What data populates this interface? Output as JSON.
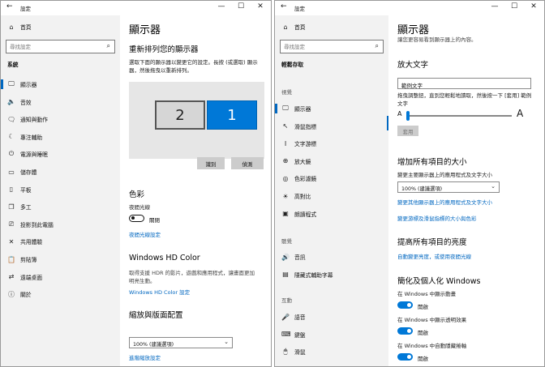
{
  "left_window": {
    "title": "設定",
    "controls": {
      "minimize": "—",
      "maximize": "☐",
      "close": "✕"
    },
    "nav": {
      "home_label": "首頁",
      "search_placeholder": "尋找設定",
      "section_label": "系統",
      "items": [
        {
          "label": "顯示器",
          "icon": "monitor-icon",
          "glyph": "🖵"
        },
        {
          "label": "音效",
          "icon": "speaker-icon",
          "glyph": "🔈"
        },
        {
          "label": "通知與動作",
          "icon": "notification-icon",
          "glyph": "🗨"
        },
        {
          "label": "專注輔助",
          "icon": "moon-icon",
          "glyph": "☾"
        },
        {
          "label": "電源與睡眠",
          "icon": "power-icon",
          "glyph": "⏻"
        },
        {
          "label": "儲存體",
          "icon": "storage-icon",
          "glyph": "▭"
        },
        {
          "label": "平板",
          "icon": "tablet-icon",
          "glyph": "▯"
        },
        {
          "label": "多工",
          "icon": "multitask-icon",
          "glyph": "❐"
        },
        {
          "label": "投影到此電腦",
          "icon": "project-icon",
          "glyph": "⎚"
        },
        {
          "label": "共用體驗",
          "icon": "shared-icon",
          "glyph": "✕"
        },
        {
          "label": "剪貼簿",
          "icon": "clipboard-icon",
          "glyph": "📋"
        },
        {
          "label": "遠端桌面",
          "icon": "remote-desktop-icon",
          "glyph": "⇄"
        },
        {
          "label": "關於",
          "icon": "info-icon",
          "glyph": "ⓘ"
        }
      ]
    },
    "content": {
      "page_title": "顯示器",
      "arrange_heading": "重新排列您的顯示器",
      "arrange_desc_line1": "選取下面的顯示器以變更它的設定。長按 (或選取) 顯示",
      "arrange_desc_line2": "器，然後拖曳以重新排列。",
      "monitor_2_label": "2",
      "monitor_1_label": "1",
      "identify_button": "識別",
      "detect_button": "偵測",
      "color_heading": "色彩",
      "night_light_label": "夜間光線",
      "night_light_state": "關閉",
      "night_light_link": "夜間光線設定",
      "hd_color_heading": "Windows HD Color",
      "hd_color_desc_line1": "取得支援 HDR 的影片，遊戲和應用程式，讓畫面更加",
      "hd_color_desc_line2": "明亮生動。",
      "hd_color_link": "Windows HD Color 設定",
      "scale_heading": "縮放與版面配置",
      "scale_dropdown_value": "100% (建議選項)",
      "scale_link": "進階縮放設定"
    }
  },
  "right_window": {
    "title": "設定",
    "controls": {
      "minimize": "—",
      "maximize": "☐",
      "close": "✕"
    },
    "nav": {
      "home_label": "首頁",
      "search_placeholder": "尋找設定",
      "section_label": "輕鬆存取",
      "group_vision": "視覺",
      "vision_items": [
        {
          "label": "顯示器",
          "icon": "monitor-icon",
          "glyph": "🖵"
        },
        {
          "label": "滑鼠指標",
          "icon": "mouse-pointer-icon",
          "glyph": "↖"
        },
        {
          "label": "文字游標",
          "icon": "text-cursor-icon",
          "glyph": "I"
        },
        {
          "label": "放大鏡",
          "icon": "magnifier-icon",
          "glyph": "⊕"
        },
        {
          "label": "色彩濾鏡",
          "icon": "color-filter-icon",
          "glyph": "◎"
        },
        {
          "label": "高對比",
          "icon": "high-contrast-icon",
          "glyph": "☀"
        },
        {
          "label": "朗讀程式",
          "icon": "narrator-icon",
          "glyph": "▣"
        }
      ],
      "group_hearing": "聽覺",
      "hearing_items": [
        {
          "label": "音訊",
          "icon": "audio-icon",
          "glyph": "🔊"
        },
        {
          "label": "隱藏式輔助字幕",
          "icon": "closed-caption-icon",
          "glyph": "▤"
        }
      ],
      "group_interaction": "互動",
      "interaction_items": [
        {
          "label": "語音",
          "icon": "microphone-icon",
          "glyph": "🎤"
        },
        {
          "label": "鍵盤",
          "icon": "keyboard-icon",
          "glyph": "⌨"
        },
        {
          "label": "滑鼠",
          "icon": "mouse-icon",
          "glyph": "🖱"
        }
      ]
    },
    "content": {
      "page_title": "顯示器",
      "page_subtitle": "讓您更容易看到顯示器上的內容。",
      "text_size_heading": "放大文字",
      "sample_text": "範例文字",
      "slider_desc_line1": "拖曳調整鈕，直到您輕鬆地讀取，然後按一下 [套用] 範例",
      "slider_desc_line2": "文字",
      "slider_min_label": "A",
      "slider_max_label": "A",
      "slider_value_percent": 0,
      "apply_button": "套用",
      "size_heading": "增加所有項目的大小",
      "size_desc": "變更主要顯示器上的應用程式及文字大小",
      "size_dropdown_value": "100% (建議選項)",
      "other_display_link": "變更其他顯示器上的應用程式及文字大小",
      "pointer_link": "變更游標及滑鼠指標的大小與色彩",
      "brightness_heading": "提高所有項目的亮度",
      "night_light_link": "自動變更亮度，或使用夜間光線",
      "personalize_heading": "簡化及個人化 Windows",
      "animations_label": "在 Windows 中顯示動畫",
      "animations_state": "開啟",
      "transparency_label": "在 Windows 中顯示透明效果",
      "transparency_state": "開啟",
      "scrollbars_label": "在 Windows 中自動隱藏捲軸",
      "scrollbars_state": "開啟"
    }
  },
  "colors": {
    "accent": "#0078d7",
    "link": "#0067c0",
    "nav_bg": "#f2f2f2"
  }
}
